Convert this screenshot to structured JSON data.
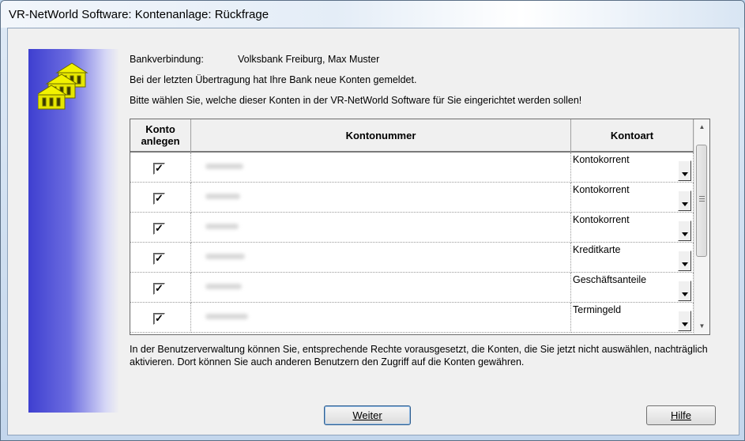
{
  "window": {
    "title": "VR-NetWorld Software: Kontenanlage: Rückfrage"
  },
  "header": {
    "bank_label": "Bankverbindung:",
    "bank_value": "Volksbank Freiburg, Max Muster",
    "line1": "Bei der letzten Übertragung hat Ihre Bank neue Konten gemeldet.",
    "line2": "Bitte wählen Sie, welche dieser Konten in der VR-NetWorld Software für Sie eingerichtet werden sollen!"
  },
  "table": {
    "columns": [
      "Konto\nanlegen",
      "Kontonummer",
      "Kontoart"
    ],
    "rows": [
      {
        "checked": true,
        "kontoart": "Kontokorrent"
      },
      {
        "checked": true,
        "kontoart": "Kontokorrent"
      },
      {
        "checked": true,
        "kontoart": "Kontokorrent"
      },
      {
        "checked": true,
        "kontoart": "Kreditkarte"
      },
      {
        "checked": true,
        "kontoart": "Geschäftsanteile"
      },
      {
        "checked": true,
        "kontoart": "Termingeld"
      }
    ]
  },
  "footer_note": "In der Benutzerverwaltung können Sie, entsprechende Rechte vorausgesetzt, die Konten, die Sie jetzt nicht auswählen, nachträglich aktivieren. Dort können Sie auch anderen Benutzern den Zugriff auf die Konten gewähren.",
  "buttons": {
    "weiter": "Weiter",
    "hilfe": "Hilfe"
  },
  "icons": {
    "side": "bank-buildings-icon",
    "check": "checkmark-icon",
    "dropdown": "dropdown-arrow-icon"
  }
}
